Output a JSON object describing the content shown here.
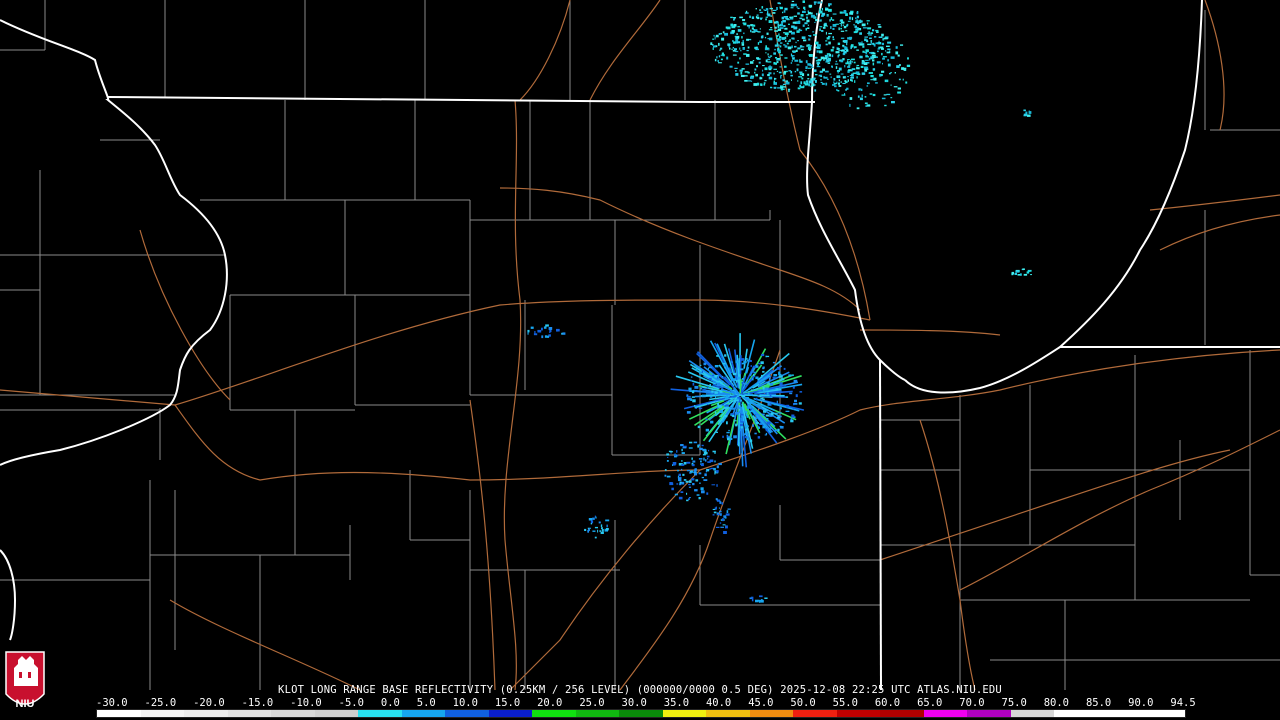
{
  "caption": "KLOT LONG RANGE BASE REFLECTIVITY (0.25KM / 256 LEVEL) (000000/0000 0.5 DEG) 2025-12-08 22:25 UTC  ATLAS.NIU.EDU",
  "logo_text": "NIU",
  "colors": {
    "background": "#000000",
    "state_border": "#ffffff",
    "county_line": "#8a8a8a",
    "highway": "#b06a3a",
    "logo_red": "#c8102e"
  },
  "scale": {
    "labels": [
      "-30.0",
      "-25.0",
      "-20.0",
      "-15.0",
      "-10.0",
      "-5.0",
      "0.0",
      "5.0",
      "10.0",
      "15.0",
      "20.0",
      "25.0",
      "30.0",
      "35.0",
      "40.0",
      "45.0",
      "50.0",
      "55.0",
      "60.0",
      "65.0",
      "70.0",
      "75.0",
      "80.0",
      "85.0",
      "90.0",
      "94.5"
    ],
    "colors": [
      "#ffffff",
      "#f4f4f4",
      "#ececec",
      "#e2e2e2",
      "#d8d8d8",
      "#cfcfcf",
      "#28e0f0",
      "#16a6f0",
      "#1060e0",
      "#0a1ecc",
      "#10e010",
      "#10b810",
      "#0a8a0a",
      "#f0f010",
      "#f0c010",
      "#f08c10",
      "#f02010",
      "#c00000",
      "#b00000",
      "#f000f0",
      "#b000c0",
      "#d8d8d8",
      "#ffffff",
      "#ffffff",
      "#ffffff"
    ]
  }
}
